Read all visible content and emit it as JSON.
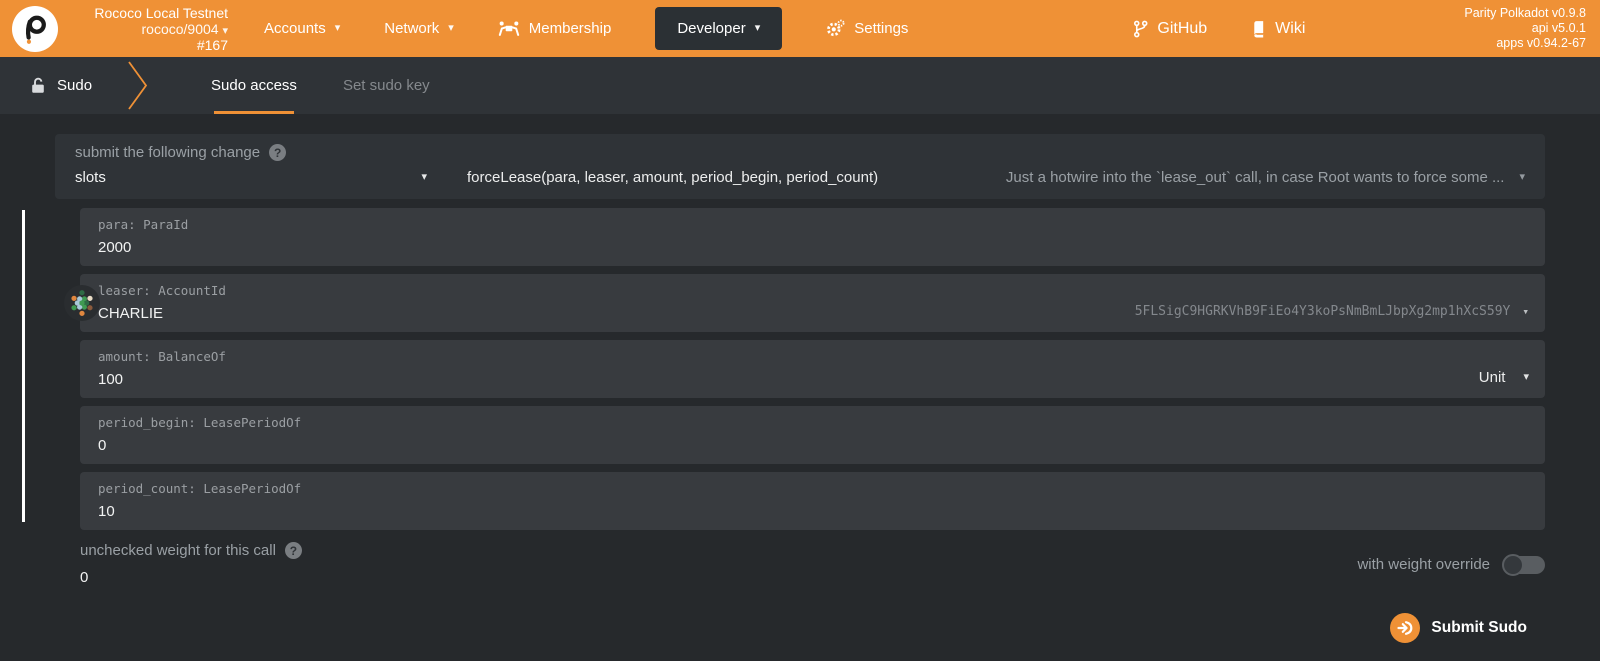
{
  "theme": {
    "accent": "#ef9136",
    "header_bg": "#ef9136",
    "page_bg": "#26292c",
    "bar_bg": "#2f3337",
    "field_bg": "#383b3f"
  },
  "header": {
    "chain": {
      "name": "Rococo Local Testnet",
      "spec": "rococo/9004",
      "block": "#167"
    },
    "nav": {
      "accounts": "Accounts",
      "network": "Network",
      "membership": "Membership",
      "developer": "Developer",
      "settings": "Settings"
    },
    "links": {
      "github": "GitHub",
      "wiki": "Wiki"
    },
    "versions": {
      "node": "Parity Polkadot v0.9.8",
      "api": "api v5.0.1",
      "apps": "apps v0.94.2-67"
    }
  },
  "tabbar": {
    "section": "Sudo",
    "tabs": [
      {
        "label": "Sudo access",
        "active": true
      },
      {
        "label": "Set sudo key",
        "active": false
      }
    ]
  },
  "form": {
    "section_label": "submit the following change",
    "pallet": "slots",
    "method": "forceLease(para, leaser, amount, period_begin, period_count)",
    "method_help": "Just a hotwire into the `lease_out` call, in case Root wants to force some ...",
    "params": [
      {
        "label": "para: ParaId",
        "value": "2000"
      },
      {
        "label": "leaser: AccountId",
        "value": "CHARLIE",
        "address": "5FLSigC9HGRKVhB9FiEo4Y3koPsNmBmLJbpXg2mp1hXcS59Y",
        "identicon_dots": [
          "#2e6b45",
          "#e8dcc6",
          "#8a5a3c",
          "#e0873f",
          "#3f9a52",
          "#e0873f",
          "#3f9a52",
          "#2e6b45",
          "#3f9a52",
          "#a8c8d8",
          "#a8c8d8",
          "#a8c8d8",
          "#3f9a52"
        ]
      },
      {
        "label": "amount: BalanceOf",
        "value": "100",
        "unit": "Unit"
      },
      {
        "label": "period_begin: LeasePeriodOf",
        "value": "0"
      },
      {
        "label": "period_count: LeasePeriodOf",
        "value": "10"
      }
    ],
    "weight_label": "unchecked weight for this call",
    "weight_value": "0",
    "weight_override_label": "with weight override",
    "submit_label": "Submit Sudo"
  }
}
